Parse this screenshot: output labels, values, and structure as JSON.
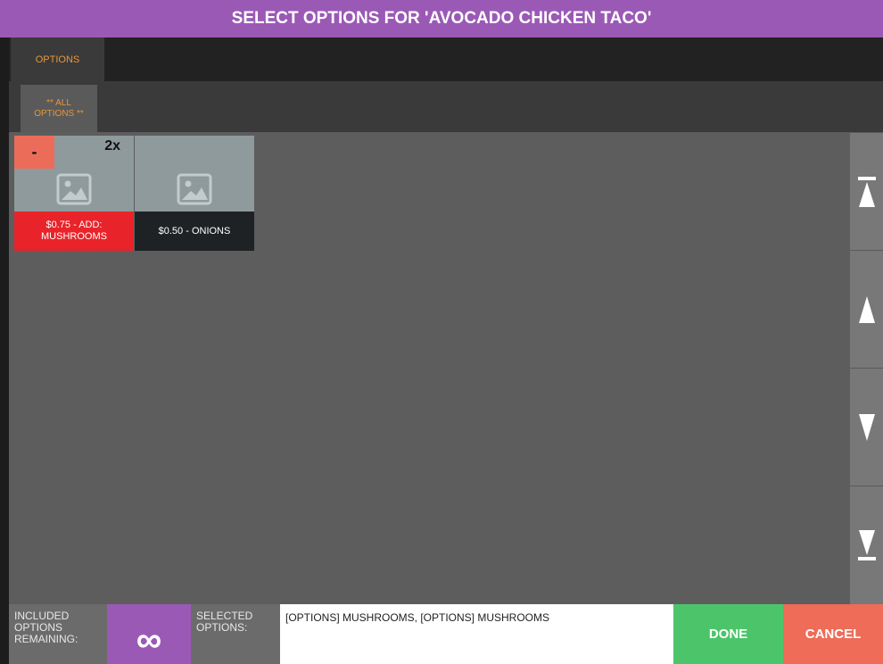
{
  "dialog": {
    "title": "SELECT OPTIONS FOR 'AVOCADO CHICKEN TACO'"
  },
  "tabs": [
    {
      "label": "OPTIONS"
    }
  ],
  "subtabs": [
    {
      "label": "** ALL OPTIONS **"
    }
  ],
  "options": [
    {
      "caption": "$0.75 - ADD: MUSHROOMS",
      "quantity": "2x",
      "minus_label": "-",
      "selected": true
    },
    {
      "caption": "$0.50 - ONIONS",
      "selected": false
    }
  ],
  "scroll": {
    "icons": [
      "scroll-to-top-icon",
      "scroll-up-icon",
      "scroll-down-icon",
      "scroll-to-bottom-icon"
    ]
  },
  "footer": {
    "included_label": "INCLUDED OPTIONS REMAINING:",
    "included_value": "∞",
    "selected_label": "SELECTED OPTIONS:",
    "selected_value": "[OPTIONS] MUSHROOMS, [OPTIONS] MUSHROOMS",
    "done_label": "DONE",
    "cancel_label": "CANCEL"
  },
  "colors": {
    "title_bar": "#9b59b6",
    "selected_caption": "#e8242a",
    "minus_button": "#ec6c5a",
    "done": "#4cc56a",
    "cancel": "#ee6c58",
    "tab_text": "#e8953a"
  }
}
